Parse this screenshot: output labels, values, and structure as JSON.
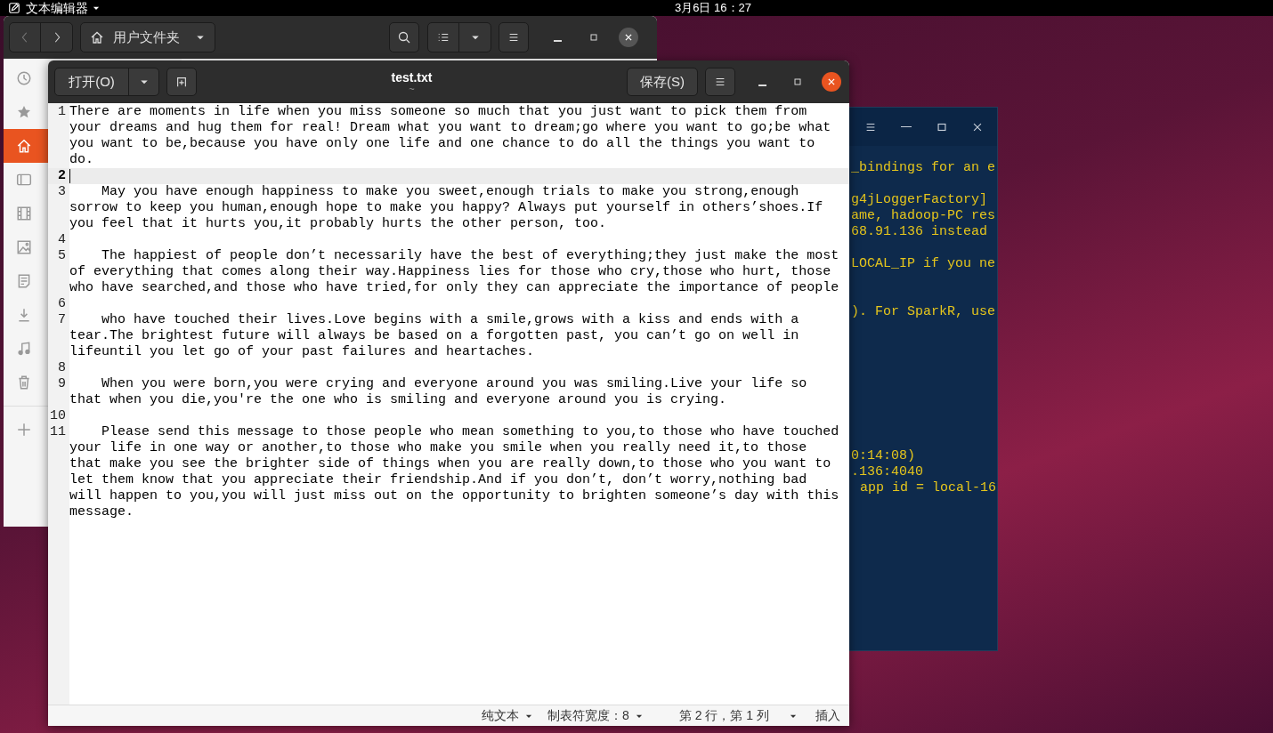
{
  "top_bar": {
    "app_menu": "文本编辑器",
    "clock": "3月6日 16：27"
  },
  "file_manager": {
    "location": "用户文件夹",
    "sidebar": [
      {
        "selected": false
      },
      {
        "selected": false
      },
      {
        "selected": true
      },
      {
        "selected": false
      },
      {
        "selected": false
      },
      {
        "selected": false
      },
      {
        "selected": false
      },
      {
        "selected": false
      },
      {
        "selected": false
      },
      {
        "selected": false
      },
      {
        "selected": false
      }
    ]
  },
  "terminal": {
    "lines": [
      "_bindings for an e",
      "g4jLoggerFactory]",
      "ame, hadoop-PC res",
      "68.91.136 instead",
      "LOCAL_IP if you ne",
      "). For SparkR, use",
      "0:14:08)",
      ".136:4040",
      "app id = local-16"
    ]
  },
  "editor": {
    "title": "test.txt",
    "subtitle": "~",
    "open_button": "打开(O)",
    "save_button": "保存(S)",
    "lines": [
      {
        "number": "1",
        "current": false,
        "text": "There are moments in life when you miss someone so much that you just want to pick them from your dreams and hug them for real! Dream what you want to dream;go where you want to go;be what you want to be,because you have only one life and one chance to do all the things you want to do."
      },
      {
        "number": "2",
        "current": true
      },
      {
        "number": "3",
        "current": false,
        "text": "    May you have enough happiness to make you sweet,enough trials to make you strong,enough sorrow to keep you human,enough hope to make you happy? Always put yourself in others’shoes.If you feel that it hurts you,it probably hurts the other person, too."
      },
      {
        "number": "4",
        "current": false
      },
      {
        "number": "5",
        "current": false,
        "text": "    The happiest of people don’t necessarily have the best of everything;they just make the most of everything that comes along their way.Happiness lies for those who cry,those who hurt, those who have searched,and those who have tried,for only they can appreciate the importance of people"
      },
      {
        "number": "6",
        "current": false
      },
      {
        "number": "7",
        "current": false,
        "text": "    who have touched their lives.Love begins with a smile,grows with a kiss and ends with a tear.The brightest future will always be based on a forgotten past, you can’t go on well in lifeuntil you let go of your past failures and heartaches."
      },
      {
        "number": "8",
        "current": false
      },
      {
        "number": "9",
        "current": false,
        "text": "    When you were born,you were crying and everyone around you was smiling.Live your life so that when you die,you're the one who is smiling and everyone around you is crying."
      },
      {
        "number": "10",
        "current": false
      },
      {
        "number": "11",
        "current": false,
        "text": "    Please send this message to those people who mean something to you,to those who have touched your life in one way or another,to those who make you smile when you really need it,to those that make you see the brighter side of things when you are really down,to those who you want to let them know that you appreciate their friendship.And if you don’t, don’t worry,nothing bad will happen to you,you will just miss out on the opportunity to brighten someone’s day with this message."
      }
    ],
    "status_bar": {
      "language": "纯文本",
      "tab_width": "制表符宽度：8",
      "position": "第 2 行，第 1 列",
      "mode": "插入"
    }
  }
}
